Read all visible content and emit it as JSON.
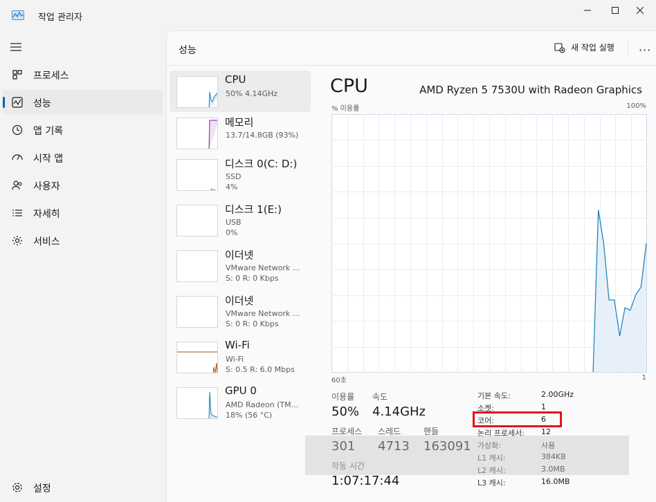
{
  "window": {
    "title": "작업 관리자"
  },
  "nav": {
    "items": [
      {
        "label": "프로세스"
      },
      {
        "label": "성능"
      },
      {
        "label": "앱 기록"
      },
      {
        "label": "시작 앱"
      },
      {
        "label": "사용자"
      },
      {
        "label": "자세히"
      },
      {
        "label": "서비스"
      }
    ],
    "settings_label": "설정"
  },
  "header": {
    "title": "성능",
    "new_task_label": "새 작업 실행",
    "more": "···"
  },
  "devices": [
    {
      "name": "CPU",
      "line1": "50% 4.14GHz",
      "line2": ""
    },
    {
      "name": "메모리",
      "line1": "13.7/14.8GB (93%)",
      "line2": ""
    },
    {
      "name": "디스크 0(C: D:)",
      "line1": "SSD",
      "line2": "4%"
    },
    {
      "name": "디스크 1(E:)",
      "line1": "USB",
      "line2": "0%"
    },
    {
      "name": "이더넷",
      "line1": "VMware Network ...",
      "line2": "S: 0 R: 0 Kbps"
    },
    {
      "name": "이더넷",
      "line1": "VMware Network ...",
      "line2": "S: 0 R: 0 Kbps"
    },
    {
      "name": "Wi-Fi",
      "line1": "Wi-Fi",
      "line2": "S: 0.5 R: 6.0 Mbps"
    },
    {
      "name": "GPU 0",
      "line1": "AMD Radeon (TM...",
      "line2": "18% (56 °C)"
    }
  ],
  "detail": {
    "title": "CPU",
    "model": "AMD Ryzen 5 7530U with Radeon Graphics",
    "y_label": "% 이용률",
    "y_max_label": "100%",
    "x_left_label": "60초",
    "x_right_label": "1",
    "stats": {
      "utilization_label": "이용률",
      "utilization": "50%",
      "speed_label": "속도",
      "speed": "4.14GHz",
      "processes_label": "프로세스",
      "processes": "301",
      "threads_label": "스레드",
      "threads": "4713",
      "handles_label": "핸들",
      "handles": "163091",
      "uptime_label": "작동 시간",
      "uptime": "1:07:17:44"
    },
    "specs": [
      {
        "k": "기본 속도:",
        "v": "2.00GHz"
      },
      {
        "k": "소켓:",
        "v": "1"
      },
      {
        "k": "코어:",
        "v": "6"
      },
      {
        "k": "논리 프로세서:",
        "v": "12"
      },
      {
        "k": "가상화:",
        "v": "사용"
      },
      {
        "k": "L1 캐시:",
        "v": "384KB"
      },
      {
        "k": "L2 캐시:",
        "v": "3.0MB"
      },
      {
        "k": "L3 캐시:",
        "v": "16.0MB"
      }
    ]
  },
  "chart_data": {
    "type": "area",
    "x": [
      60,
      59,
      58,
      57,
      56,
      55,
      54,
      53,
      52,
      51,
      50,
      49,
      48,
      47,
      46,
      45,
      44,
      43,
      42,
      41,
      40,
      39,
      38,
      37,
      36,
      35,
      34,
      33,
      32,
      31,
      30,
      29,
      28,
      27,
      26,
      25,
      24,
      23,
      22,
      21,
      20,
      19,
      18,
      17,
      16,
      15,
      14,
      13,
      12,
      11,
      10,
      9,
      8,
      7,
      6,
      5,
      4,
      3,
      2,
      1
    ],
    "values": [
      0,
      0,
      0,
      0,
      0,
      0,
      0,
      0,
      0,
      0,
      0,
      0,
      0,
      0,
      0,
      0,
      0,
      0,
      0,
      0,
      0,
      0,
      0,
      0,
      0,
      0,
      0,
      0,
      0,
      0,
      0,
      0,
      0,
      0,
      0,
      0,
      0,
      0,
      0,
      0,
      0,
      0,
      0,
      0,
      0,
      0,
      0,
      0,
      0,
      0,
      63,
      50,
      28,
      28,
      14,
      25,
      24,
      30,
      33,
      50
    ],
    "ylim": [
      0,
      100
    ],
    "xlabel": "",
    "ylabel": "% 이용률",
    "grid": true,
    "color": "#117dbb"
  }
}
